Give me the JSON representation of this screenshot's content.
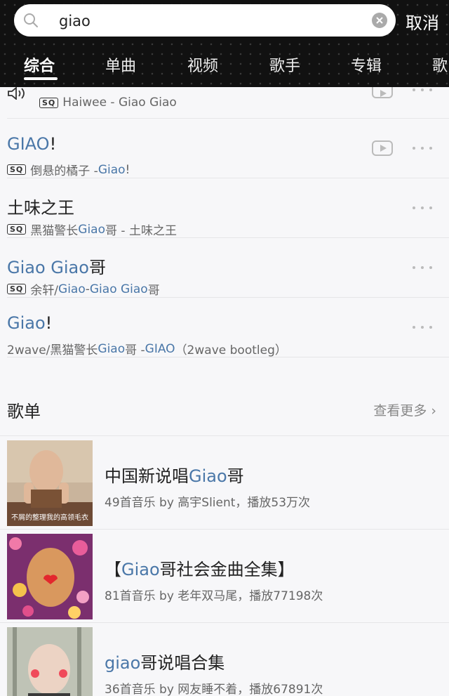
{
  "search": {
    "query": "giao",
    "cancel_label": "取消"
  },
  "tabs": [
    "综合",
    "单曲",
    "视频",
    "歌手",
    "专辑",
    "歌"
  ],
  "songs": [
    {
      "title": "",
      "sub_prefix": "Haiwee - Giao Giao",
      "sq": "SQ",
      "partial": true
    },
    {
      "title_hl": "GIAO",
      "title_rest": "!",
      "sq": "SQ",
      "sub_a": "倒悬的橘子 - ",
      "sub_hl": "Giao",
      "sub_b": "!",
      "has_video": true
    },
    {
      "title_rest": "土味之王",
      "sq": "SQ",
      "sub_a": "黑猫警长",
      "sub_hl": "Giao",
      "sub_b": "哥 - 土味之王"
    },
    {
      "title_hl": "Giao Giao",
      "title_rest": "哥",
      "sq": "SQ",
      "sub_a": "余轩/",
      "sub_hl": "Giao",
      "sub_b": " - ",
      "sub_hl2": "Giao Giao",
      "sub_c": "哥"
    },
    {
      "title_hl": "Giao",
      "title_rest": "!",
      "sub_a": "2wave/黑猫警长",
      "sub_hl": "Giao",
      "sub_b": "哥 - ",
      "sub_hl2": "GIAO",
      "sub_c": "（2wave bootleg）"
    }
  ],
  "playlists_section": {
    "title": "歌单",
    "see_more": "查看更多 ›"
  },
  "playlists": [
    {
      "title_a": "中国新说唱",
      "title_hl": "Giao",
      "title_b": "哥",
      "sub": "49首音乐  by 高宇Slient，播放53万次",
      "caption": "不屑的整理我的高领毛衣"
    },
    {
      "title_a": "【",
      "title_hl": "Giao",
      "title_b": "哥社会金曲全集】",
      "sub": "81首音乐  by 老年双马尾，播放77198次"
    },
    {
      "title_a": "",
      "title_hl": "giao",
      "title_b": "哥说唱合集",
      "sub": "36首音乐  by 网友睡不着，播放67891次"
    }
  ],
  "colors": {
    "highlight": "#4a77a8",
    "header_bg": "#111111"
  }
}
